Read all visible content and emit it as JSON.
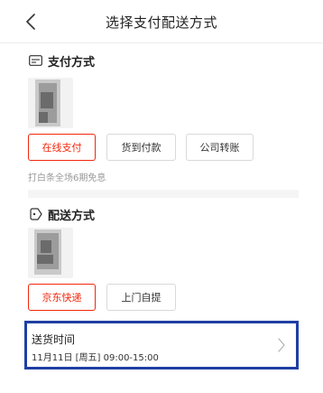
{
  "header": {
    "title": "选择支付配送方式",
    "back_icon": "chevron-left-icon"
  },
  "payment": {
    "title": "支付方式",
    "icon": "card-icon",
    "options": [
      {
        "label": "在线支付",
        "selected": true
      },
      {
        "label": "货到付款",
        "selected": false
      },
      {
        "label": "公司转账",
        "selected": false
      }
    ],
    "note": "打白条全场6期免息"
  },
  "shipping": {
    "title": "配送方式",
    "icon": "tag-icon",
    "options": [
      {
        "label": "京东快递",
        "selected": true
      },
      {
        "label": "上门自提",
        "selected": false
      }
    ]
  },
  "delivery_time": {
    "title": "送货时间",
    "value": "11月11日 [周五] 09:00-15:00",
    "chevron_icon": "chevron-right-icon"
  },
  "colors": {
    "accent": "#f2270c",
    "highlight_border": "#1f3fa3",
    "muted_text": "#999999"
  }
}
